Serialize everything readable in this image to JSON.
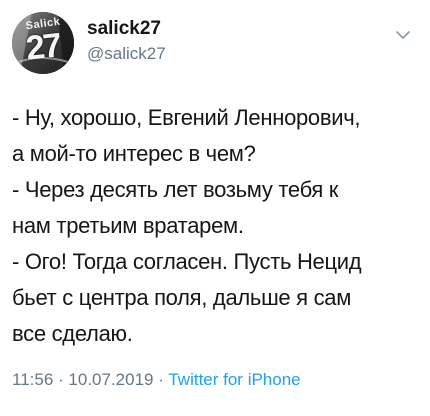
{
  "tweet": {
    "author": {
      "display_name": "salick27",
      "handle": "@salick27",
      "avatar_text": "Salick",
      "avatar_number": "27"
    },
    "menu_icon": "chevron-down-icon",
    "lines": [
      "- Ну, хорошо, Евгений Леннорович,",
      "а мой-то интерес в чем?",
      "- Через десять лет возьму тебя к",
      "нам третьим вратарем.",
      "- Ого! Тогда согласен. Пусть Нецид",
      "бьет с центра поля, дальше я сам",
      "все сделаю."
    ],
    "time": "11:56",
    "separator": "·",
    "date": "10.07.2019",
    "source": "Twitter for iPhone"
  },
  "colors": {
    "text": "#14171a",
    "secondary": "#657786",
    "link": "#1da1f2"
  }
}
